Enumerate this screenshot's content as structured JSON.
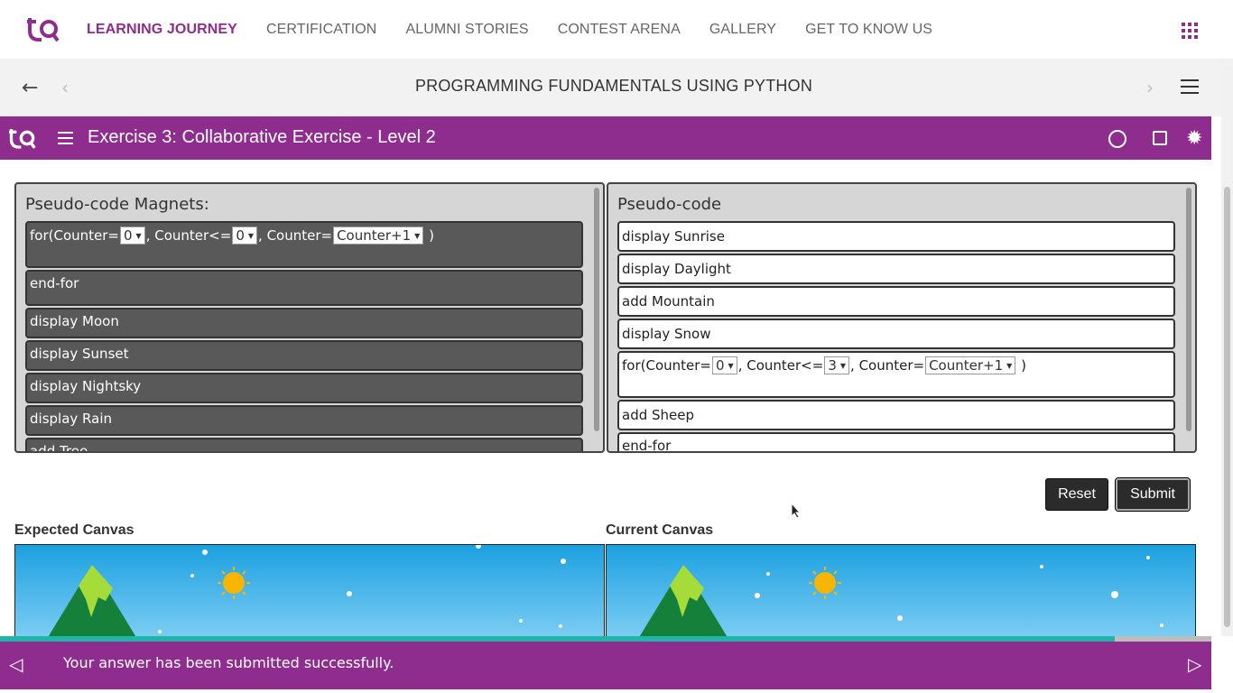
{
  "nav": {
    "links": [
      "LEARNING JOURNEY",
      "CERTIFICATION",
      "ALUMNI STORIES",
      "CONTEST ARENA",
      "GALLERY",
      "GET TO KNOW US"
    ],
    "active_color": "#8e2d8e"
  },
  "course": {
    "title": "PROGRAMMING FUNDAMENTALS USING PYTHON"
  },
  "exercise": {
    "title": "Exercise 3: Collaborative Exercise - Level 2",
    "bar_color": "#8e2d8e"
  },
  "magnets": {
    "title": "Pseudo-code Magnets:",
    "for_loop": {
      "prefix": "for(Counter=",
      "start": "0",
      "cond_label": ", Counter<=",
      "end": "0",
      "step_label": ", Counter=",
      "step": "Counter+1",
      "suffix": " )"
    },
    "items": [
      "end-for",
      "display Moon",
      "display Sunset",
      "display Nightsky",
      "display Rain",
      "add Tree"
    ]
  },
  "pseudo": {
    "title": "Pseudo-code",
    "items_before": [
      "display Sunrise",
      "display Daylight",
      "add Mountain",
      "display Snow"
    ],
    "for_loop": {
      "prefix": "for(Counter=",
      "start": "0",
      "cond_label": ", Counter<=",
      "end": "3",
      "step_label": ", Counter=",
      "step": "Counter+1",
      "suffix": " )"
    },
    "items_after": [
      "add Sheep",
      "end-for"
    ]
  },
  "buttons": {
    "reset": "Reset",
    "submit": "Submit"
  },
  "canvas": {
    "expected": "Expected Canvas",
    "current": "Current Canvas"
  },
  "status": {
    "message": "Your answer has been submitted successfully.",
    "progress": 0.92
  }
}
